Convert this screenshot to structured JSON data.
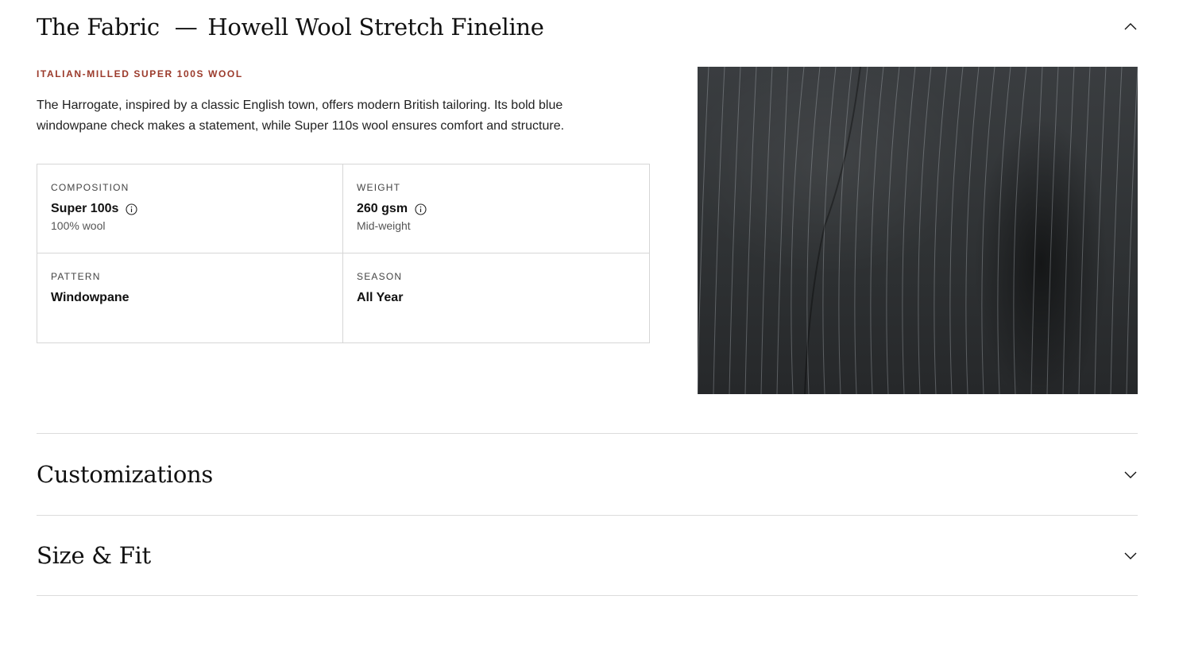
{
  "fabric": {
    "title": "The Fabric",
    "dash": "—",
    "subtitle": "Howell Wool Stretch Fineline",
    "eyebrow": "ITALIAN-MILLED SUPER 100S WOOL",
    "description": "The Harrogate, inspired by a classic English town, offers modern British tailoring. Its bold blue windowpane check makes a statement, while Super 110s wool ensures comfort and structure.",
    "specs": {
      "composition": {
        "label": "COMPOSITION",
        "value": "Super 100s",
        "sub": "100% wool"
      },
      "weight": {
        "label": "WEIGHT",
        "value": "260 gsm",
        "sub": "Mid-weight"
      },
      "pattern": {
        "label": "PATTERN",
        "value": "Windowpane"
      },
      "season": {
        "label": "SEASON",
        "value": "All Year"
      }
    },
    "image_alt": "Charcoal pinstripe wool fabric close-up",
    "expanded": true
  },
  "sections": {
    "customizations": {
      "title": "Customizations",
      "expanded": false
    },
    "size_fit": {
      "title": "Size & Fit",
      "expanded": false
    }
  },
  "colors": {
    "eyebrow": "#9b3a2b",
    "text": "#111111",
    "border": "#d6d6d6"
  },
  "icons": {
    "collapse": "chevron-up-icon",
    "expand": "chevron-down-icon",
    "info": "info-icon"
  }
}
